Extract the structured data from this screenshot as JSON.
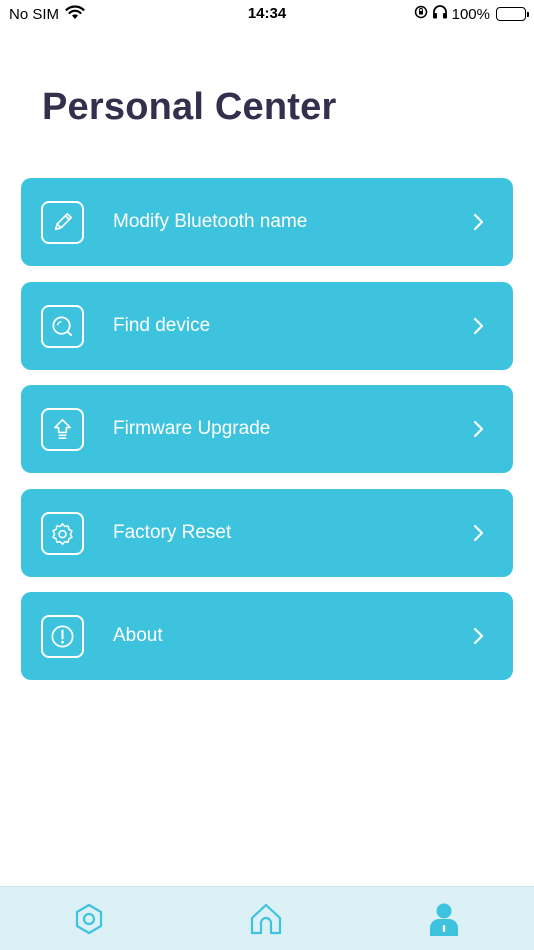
{
  "status_bar": {
    "carrier": "No SIM",
    "time": "14:34",
    "battery_percent": "100%",
    "battery_level": 1.0,
    "icons": [
      "wifi-icon",
      "orientation-lock-icon",
      "headphones-icon",
      "battery-icon"
    ]
  },
  "page": {
    "title": "Personal Center"
  },
  "menu": {
    "items": [
      {
        "label": "Modify Bluetooth name",
        "icon": "pencil-icon"
      },
      {
        "label": "Find device",
        "icon": "search-icon"
      },
      {
        "label": "Firmware Upgrade",
        "icon": "upgrade-arrow-icon"
      },
      {
        "label": "Factory Reset",
        "icon": "gear-icon"
      },
      {
        "label": "About",
        "icon": "info-icon"
      }
    ]
  },
  "tab_bar": {
    "tabs": [
      {
        "icon": "settings-hexagon-icon",
        "active": false
      },
      {
        "icon": "home-icon",
        "active": false
      },
      {
        "icon": "profile-icon",
        "active": true
      }
    ]
  },
  "colors": {
    "accent": "#3ec3de",
    "title": "#332f4d",
    "tab_bar_bg": "#dbf1f6",
    "tab_icon": "#3ec3de"
  }
}
